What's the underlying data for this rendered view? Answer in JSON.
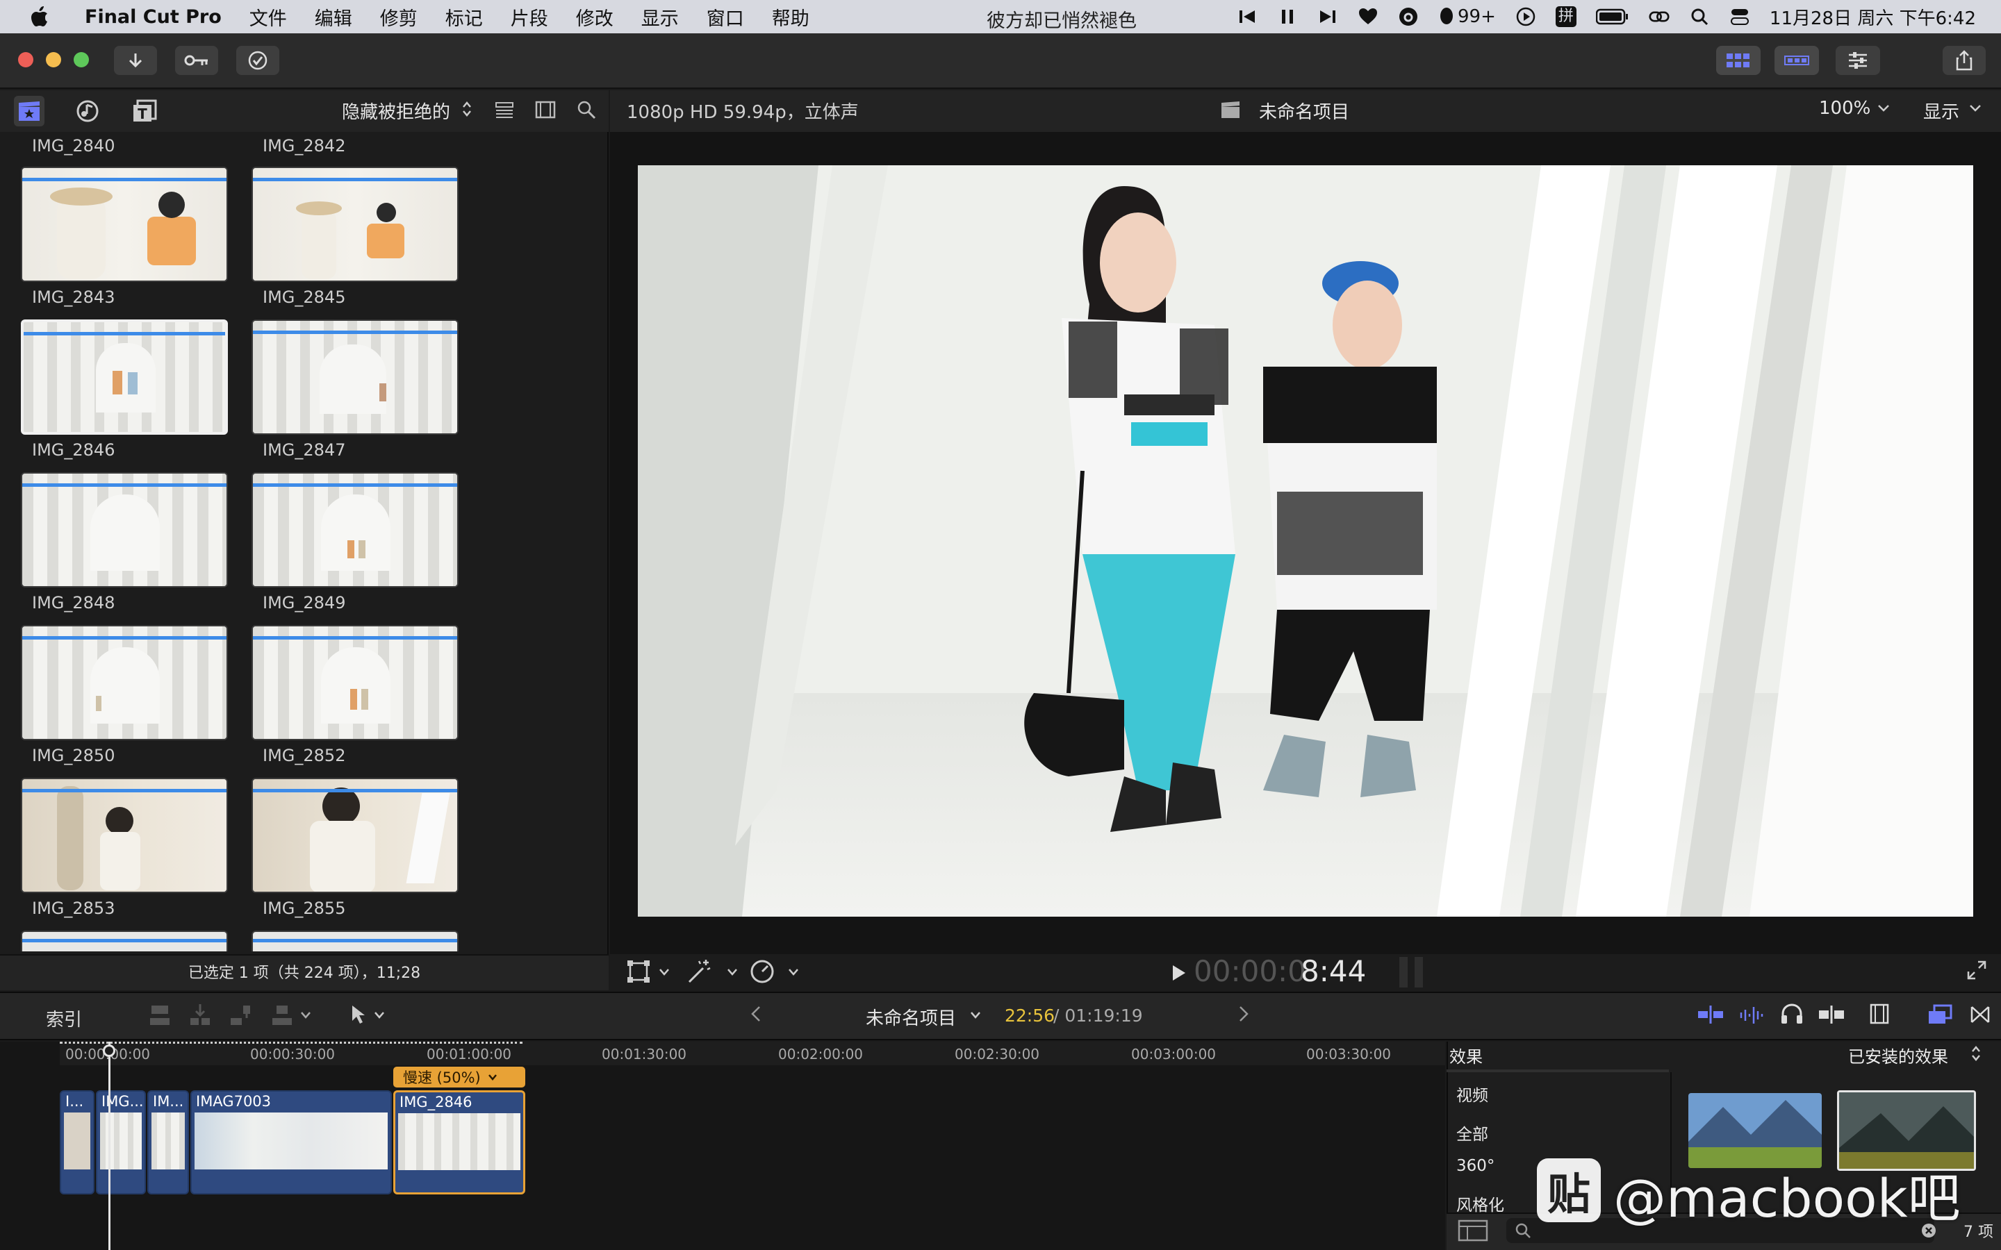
{
  "menubar": {
    "app_name": "Final Cut Pro",
    "items": [
      "文件",
      "编辑",
      "修剪",
      "标记",
      "片段",
      "修改",
      "显示",
      "窗口",
      "帮助"
    ],
    "now_playing": "彼方却已悄然褪色",
    "qq_badge": "99+",
    "input_method": "拼",
    "datetime": "11月28日 周六 下午6:42"
  },
  "browser": {
    "filter_label": "隐藏被拒绝的",
    "clips": [
      {
        "label": "IMG_2840"
      },
      {
        "label": "IMG_2842"
      },
      {
        "label": "IMG_2843"
      },
      {
        "label": "IMG_2845"
      },
      {
        "label": "IMG_2846"
      },
      {
        "label": "IMG_2847"
      },
      {
        "label": "IMG_2848"
      },
      {
        "label": "IMG_2849"
      },
      {
        "label": "IMG_2850"
      },
      {
        "label": "IMG_2852"
      },
      {
        "label": "IMG_2853"
      },
      {
        "label": "IMG_2855"
      }
    ],
    "status": "已选定 1 项（共 224 项），11;28"
  },
  "viewer": {
    "format": "1080p HD 59.94p，立体声",
    "project_title": "未命名项目",
    "zoom": "100%",
    "view_menu": "显示",
    "timecode_dim": "00:00:0",
    "timecode_bright": "8:44"
  },
  "timeline_bar": {
    "index_label": "索引",
    "project_name": "未命名项目",
    "current_duration": "22:56",
    "total_duration": "/ 01:19:19"
  },
  "timeline": {
    "ruler": [
      "00:00:00:00",
      "00:00:30:00",
      "00:01:00:00",
      "00:01:30:00",
      "00:02:00:00",
      "00:02:30:00",
      "00:03:00:00",
      "00:03:30:00"
    ],
    "clips": [
      "I...",
      "IMG...",
      "IM...",
      "IMAG7003",
      "IMG_2846"
    ],
    "speed_badge": "慢速 (50%)"
  },
  "effects": {
    "title": "效果",
    "installed": "已安装的效果",
    "categories": [
      "视频",
      "全部",
      "360°",
      "风格化"
    ],
    "count": "7 项",
    "search_placeholder": ""
  },
  "watermark": {
    "glyph": "贴",
    "text": "@macbook吧"
  },
  "colors": {
    "accent_blue": "#3d8be8",
    "clip_blue": "#2f4a80",
    "speed_orange": "#e8a236",
    "timecode_yellow": "#e8c33c"
  }
}
